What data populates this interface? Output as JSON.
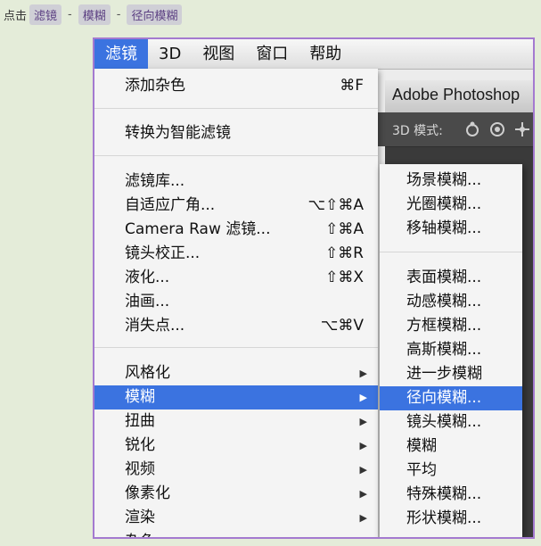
{
  "breadcrumb": {
    "prefix": "点击",
    "steps": [
      "滤镜",
      "模糊",
      "径向模糊"
    ],
    "separator": "-"
  },
  "menubar": {
    "items": [
      "滤镜",
      "3D",
      "视图",
      "窗口",
      "帮助"
    ],
    "active": "滤镜"
  },
  "photoshop": {
    "title": "Adobe Photoshop",
    "mode_label": "3D 模式:",
    "icons": [
      "rotate-3d-icon",
      "roll-3d-icon",
      "pan-3d-icon"
    ]
  },
  "filter_menu": {
    "group1": [
      {
        "label": "添加杂色",
        "shortcut": "⌘F"
      }
    ],
    "group2": [
      {
        "label": "转换为智能滤镜",
        "shortcut": ""
      }
    ],
    "group3": [
      {
        "label": "滤镜库...",
        "shortcut": ""
      },
      {
        "label": "自适应广角...",
        "shortcut": "⌥⇧⌘A"
      },
      {
        "label": "Camera Raw 滤镜...",
        "shortcut": "⇧⌘A"
      },
      {
        "label": "镜头校正...",
        "shortcut": "⇧⌘R"
      },
      {
        "label": "液化...",
        "shortcut": "⇧⌘X"
      },
      {
        "label": "油画...",
        "shortcut": ""
      },
      {
        "label": "消失点...",
        "shortcut": "⌥⌘V"
      }
    ],
    "group4": [
      {
        "label": "风格化",
        "submenu": true
      },
      {
        "label": "模糊",
        "submenu": true,
        "selected": true
      },
      {
        "label": "扭曲",
        "submenu": true
      },
      {
        "label": "锐化",
        "submenu": true
      },
      {
        "label": "视频",
        "submenu": true
      },
      {
        "label": "像素化",
        "submenu": true
      },
      {
        "label": "渲染",
        "submenu": true
      },
      {
        "label": "杂色",
        "submenu": true
      }
    ]
  },
  "blur_submenu": {
    "group1": [
      "场景模糊...",
      "光圈模糊...",
      "移轴模糊..."
    ],
    "group2": [
      "表面模糊...",
      "动感模糊...",
      "方框模糊...",
      "高斯模糊...",
      "进一步模糊",
      "径向模糊...",
      "镜头模糊...",
      "模糊",
      "平均",
      "特殊模糊...",
      "形状模糊..."
    ],
    "selected": "径向模糊..."
  },
  "colors": {
    "selection": "#3b73e0",
    "frame_border": "#a47ad0",
    "breadcrumb_pill": "#cfcfd6",
    "page_bg": "#e4ecd9"
  }
}
